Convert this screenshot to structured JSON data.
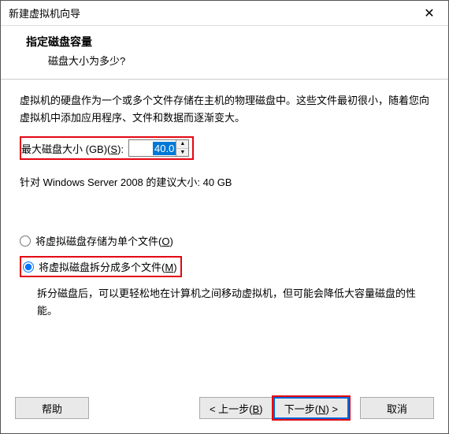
{
  "window": {
    "title": "新建虚拟机向导",
    "close_icon": "✕"
  },
  "header": {
    "title": "指定磁盘容量",
    "subtitle": "磁盘大小为多少?"
  },
  "content": {
    "description": "虚拟机的硬盘作为一个或多个文件存储在主机的物理磁盘中。这些文件最初很小，随着您向虚拟机中添加应用程序、文件和数据而逐渐变大。",
    "maxdisk_label_prefix": "最大磁盘大小 (GB)(",
    "maxdisk_label_key": "S",
    "maxdisk_label_suffix": "):",
    "maxdisk_value": "40.0",
    "recommendation": "针对 Windows Server 2008 的建议大小: 40 GB",
    "option1_text": "将虚拟磁盘存储为单个文件(",
    "option1_key": "O",
    "option1_suffix": ")",
    "option2_text": "将虚拟磁盘拆分成多个文件(",
    "option2_key": "M",
    "option2_suffix": ")",
    "option2_desc": "拆分磁盘后，可以更轻松地在计算机之间移动虚拟机，但可能会降低大容量磁盘的性能。"
  },
  "footer": {
    "help": "帮助",
    "back": "< 上一步(B)",
    "next": "下一步(N) >",
    "cancel": "取消"
  }
}
